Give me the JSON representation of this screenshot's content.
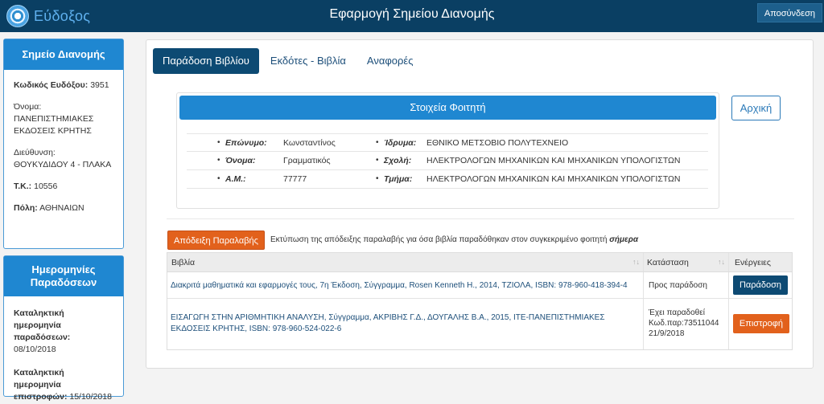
{
  "header": {
    "logo_text": "Εύδοξος",
    "title": "Εφαρμογή Σημείου Διανομής",
    "logout_label": "Αποσύνδεση",
    "accent_color": "#0a3f63"
  },
  "distribution_point": {
    "heading": "Σημείο Διανομής",
    "code_label": "Κωδικός Ευδόξου:",
    "code_value": "3951",
    "name_label": "Όνομα:",
    "name_value": "ΠΑΝΕΠΙΣΤΗΜΙΑΚΕΣ ΕΚΔΟΣΕΙΣ ΚΡΗΤΗΣ",
    "address_label": "Διεύθυνση:",
    "address_value": "ΘΟΥΚΥΔΙΔΟΥ 4 - ΠΛΑΚΑ",
    "zip_label": "Τ.Κ.:",
    "zip_value": "10556",
    "city_label": "Πόλη:",
    "city_value": "ΑΘΗΝΑΙΩΝ"
  },
  "dates": {
    "heading_line1": "Ημερομηνίες",
    "heading_line2": "Παραδόσεων",
    "delivery_label": "Καταληκτική ημερομηνία παραδόσεων:",
    "delivery_value": "08/10/2018",
    "return_label": "Καταληκτική ημερομηνία επιστροφών:",
    "return_value": "15/10/2018"
  },
  "tabs": [
    {
      "label": "Παράδοση Βιβλίου",
      "active": true
    },
    {
      "label": "Εκδότες - Βιβλία",
      "active": false
    },
    {
      "label": "Αναφορές",
      "active": false
    }
  ],
  "student": {
    "heading": "Στοιχεία Φοιτητή",
    "surname_label": "Επώνυμο:",
    "surname_value": "Κωνσταντίνος",
    "firstname_label": "Όνομα:",
    "firstname_value": "Γραμματικός",
    "am_label": "Α.Μ.:",
    "am_value": "77777",
    "institution_label": "Ίδρυμα:",
    "institution_value": "ΕΘΝΙΚΟ ΜΕΤΣΟΒΙΟ ΠΟΛΥΤΕΧΝΕΙΟ",
    "school_label": "Σχολή:",
    "school_value": "ΗΛΕΚΤΡΟΛΟΓΩΝ ΜΗΧΑΝΙΚΩΝ ΚΑΙ ΜΗΧΑΝΙΚΩΝ ΥΠΟΛΟΓΙΣΤΩΝ",
    "department_label": "Τμήμα:",
    "department_value": "ΗΛΕΚΤΡΟΛΟΓΩΝ ΜΗΧΑΝΙΚΩΝ ΚΑΙ ΜΗΧΑΝΙΚΩΝ ΥΠΟΛΟΓΙΣΤΩΝ"
  },
  "home_label": "Αρχική",
  "receipt": {
    "button_label": "Απόδειξη Παραλαβής",
    "text": "Εκτύπωση της απόδειξης παραλαβής για όσα βιβλία παραδόθηκαν στον συγκεκριμένο φοιτητή",
    "text_emphasis": "σήμερα"
  },
  "books_table": {
    "headers": [
      "Βιβλία",
      "Κατάσταση",
      "Ενέργειες"
    ],
    "rows": [
      {
        "title": "Διακριτά μαθηματικά και εφαρμογές τους, 7η Έκδοση, Σύγγραμμα, Rosen Kenneth H., 2014, ΤΖΙΟΛΑ, ISBN: 978-960-418-394-4",
        "status_line1": "Προς παράδοση",
        "status_line2": "",
        "status_line3": "",
        "action": "Παράδοση"
      },
      {
        "title_line1": "ΕΙΣΑΓΩΓΗ ΣΤΗΝ ΑΡΙΘΜΗΤΙΚΗ ΑΝΑΛΥΣΗ, Σύγγραμμα, ΑΚΡΙΒΗΣ Γ.Δ., ΔΟΥΓΑΛΗΣ Β.Α., 2015, ΙΤΕ-ΠΑΝΕΠΙΣΤΗΜΙΑΚΕΣ",
        "title_line2": "ΕΚΔΟΣΕΙΣ ΚΡΗΤΗΣ, ISBN: 978-960-524-022-6",
        "status_line1": "Έχει παραδοθεί",
        "status_line2": "Κωδ.παρ:73511044",
        "status_line3": "21/9/2018",
        "action": "Επιστροφή"
      }
    ]
  }
}
